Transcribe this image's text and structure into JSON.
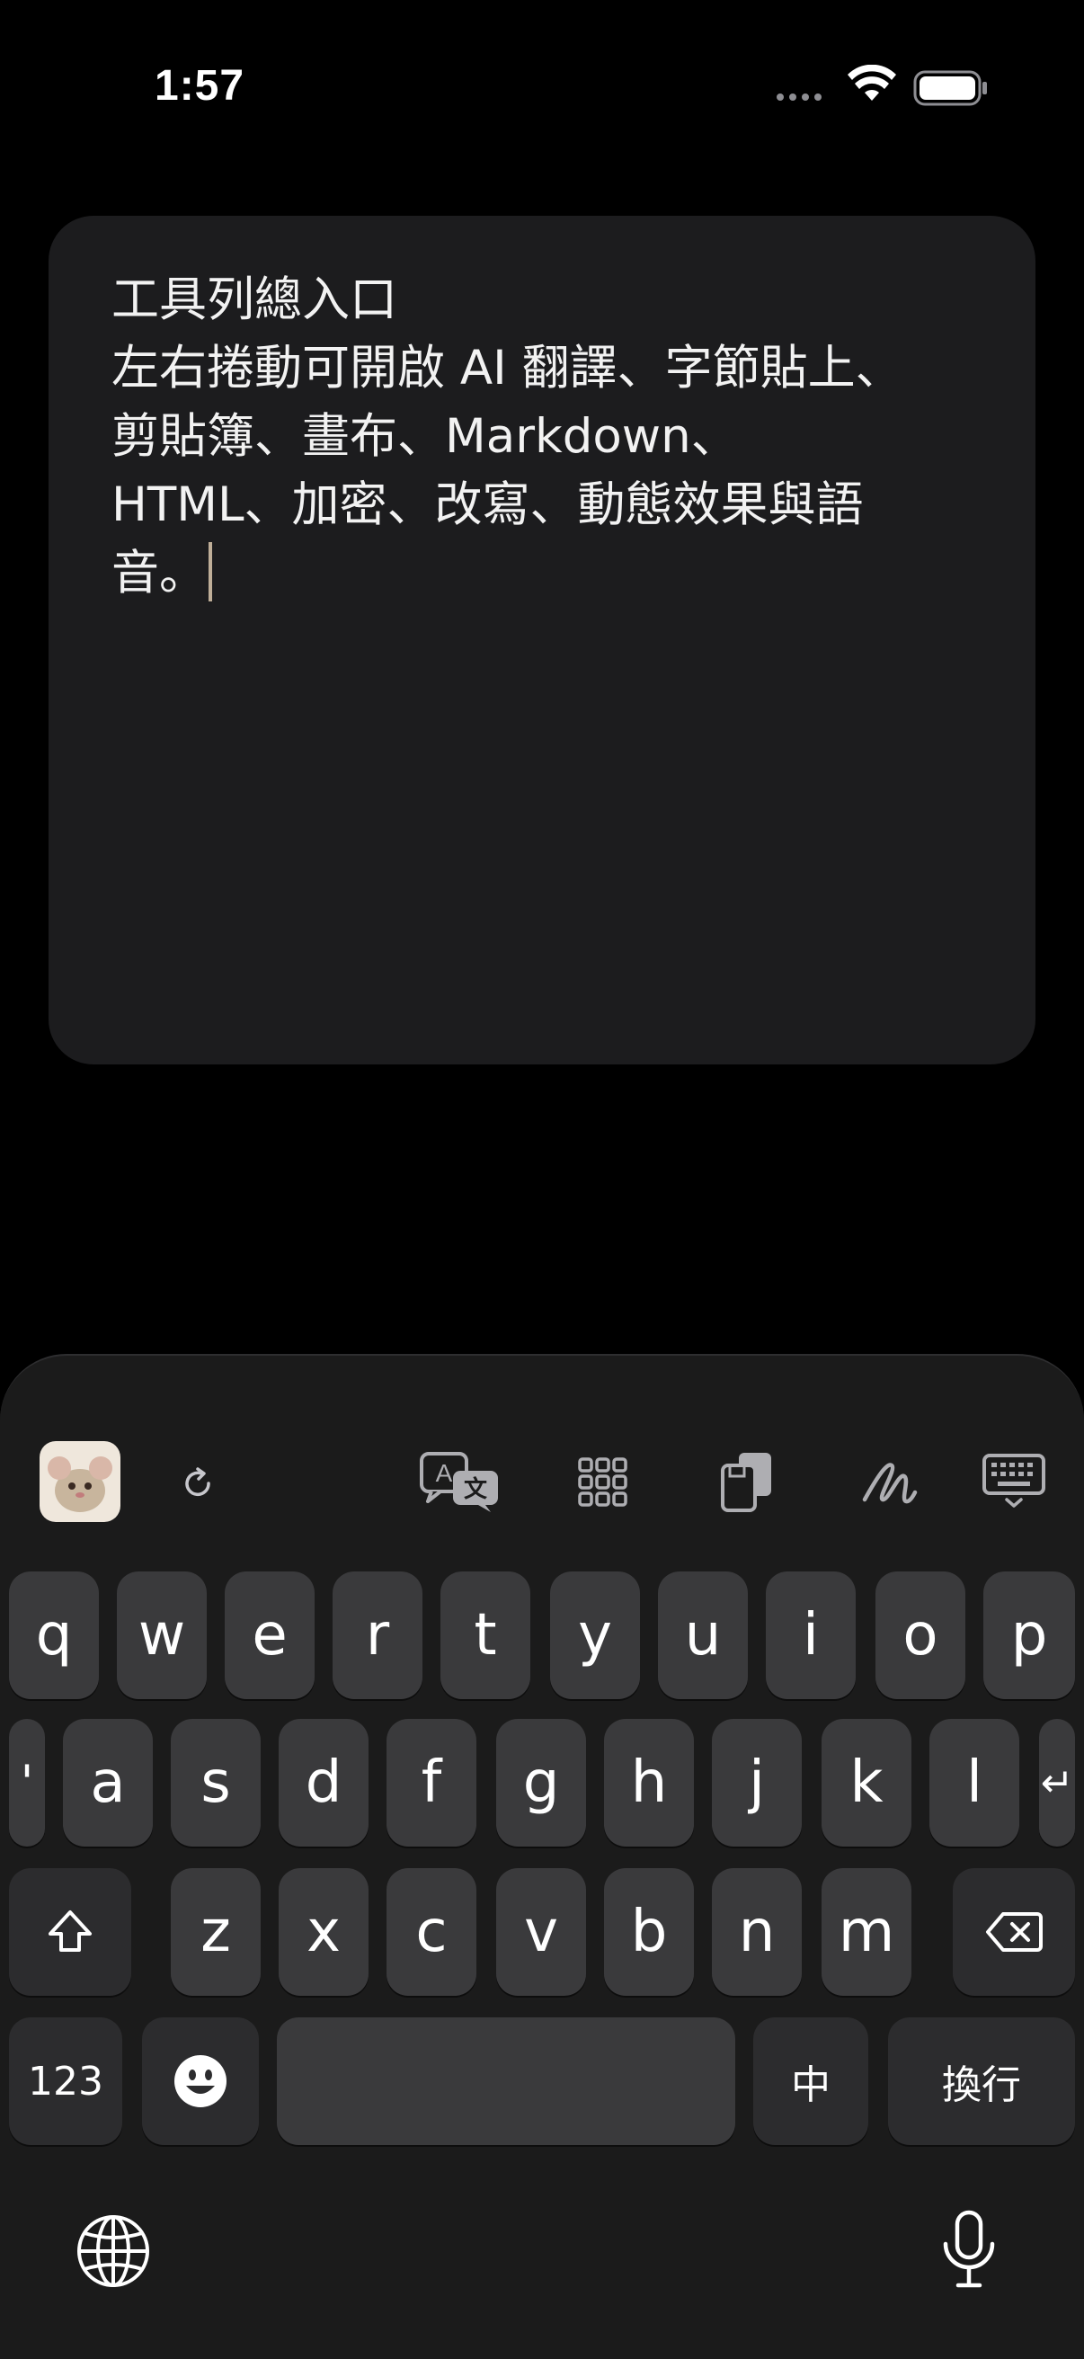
{
  "status_bar": {
    "time": "1:57"
  },
  "editor": {
    "text": "工具列總入口\n左右捲動可開啟 AI 翻譯、字節貼上、\n剪貼簿、畫布、Markdown、\nHTML、加密、改寫、動態效果與語\n音。"
  },
  "keyboard": {
    "toolbar": [
      "app-icon",
      "refresh-icon",
      "translate-icon",
      "grid-icon",
      "clipboard-icon",
      "handwriting-icon",
      "keyboard-dismiss-icon"
    ],
    "row1": [
      "q",
      "w",
      "e",
      "r",
      "t",
      "y",
      "u",
      "i",
      "o",
      "p"
    ],
    "row2": [
      "'",
      "a",
      "s",
      "d",
      "f",
      "g",
      "h",
      "j",
      "k",
      "l",
      "↵"
    ],
    "row3": [
      "z",
      "x",
      "c",
      "v",
      "b",
      "n",
      "m"
    ],
    "bottom": {
      "numbers_label": "123",
      "lang_label": "中",
      "return_label": "換行",
      "space_label": ""
    }
  },
  "colors": {
    "key": "#3a3a3c",
    "keyboard_bg": "#1b1b1b",
    "card": "#1c1c1e",
    "caret": "#bfae98"
  }
}
